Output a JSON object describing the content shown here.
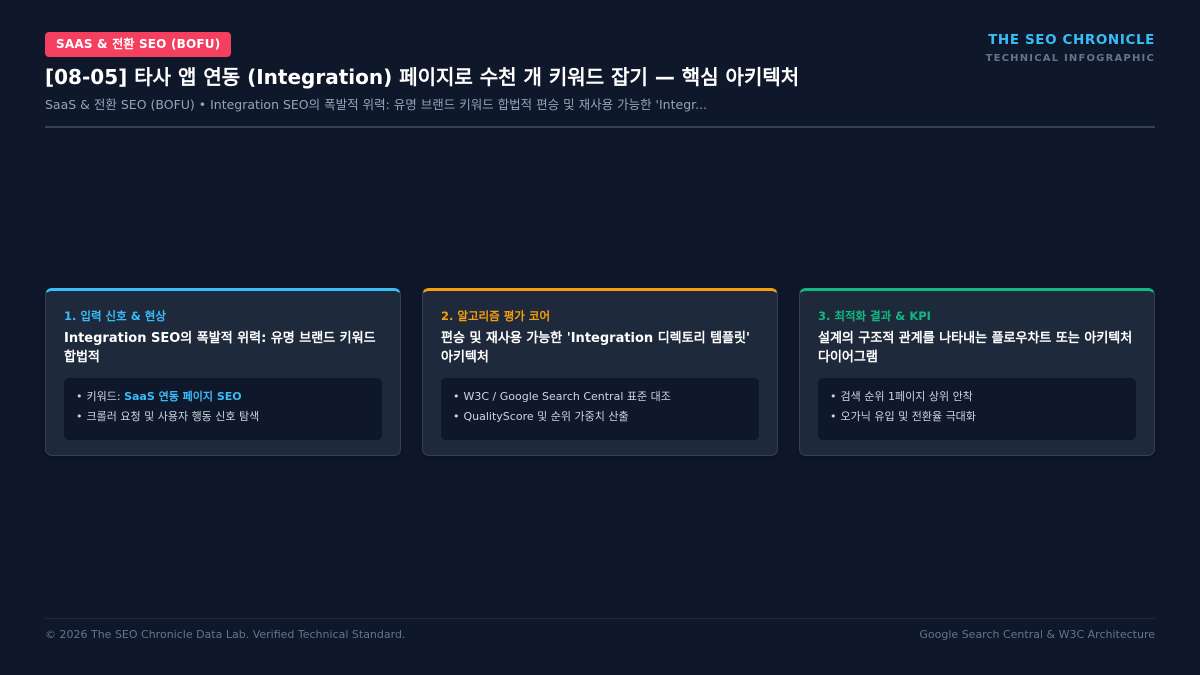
{
  "header": {
    "badge": "SAAS & 전환 SEO (BOFU)",
    "brand_name": "THE SEO CHRONICLE",
    "brand_sub": "TECHNICAL INFOGRAPHIC",
    "title": "[08-05] 타사 앱 연동 (Integration) 페이지로 수천 개 키워드 잡기 — 핵심 아키텍처",
    "subtitle": "SaaS & 전환 SEO (BOFU) • Integration SEO의 폭발적 위력: 유명 브랜드 키워드 합법적 편승 및 재사용 가능한 'Integr..."
  },
  "cards": [
    {
      "step": "1. 입력 신호 & 현상",
      "heading": "Integration SEO의 폭발적 위력: 유명 브랜드 키워드 합법적",
      "bullet1_prefix": "키워드: ",
      "bullet1_keyword": "SaaS 연동 페이지 SEO",
      "bullet2": "크롤러 요청 및 사용자 행동 신호 탐색"
    },
    {
      "step": "2. 알고리즘 평가 코어",
      "heading": "편승 및 재사용 가능한 'Integration 디렉토리 템플릿' 아키텍처",
      "bullet1": "W3C / Google Search Central 표준 대조",
      "bullet2": "QualityScore 및 순위 가중치 산출"
    },
    {
      "step": "3. 최적화 결과 & KPI",
      "heading": "설계의 구조적 관계를 나타내는 플로우차트 또는 아키텍처 다이어그램",
      "bullet1": "검색 순위 1페이지 상위 안착",
      "bullet2": "오가닉 유입 및 전환율 극대화"
    }
  ],
  "footer": {
    "left": "© 2026 The SEO Chronicle Data Lab. Verified Technical Standard.",
    "right": "Google Search Central & W3C Architecture"
  },
  "colors": {
    "background": "#0f172a",
    "badge": "#f43f5e",
    "accent_blue": "#38bdf8",
    "accent_orange": "#f59e0b",
    "accent_green": "#10b981"
  }
}
